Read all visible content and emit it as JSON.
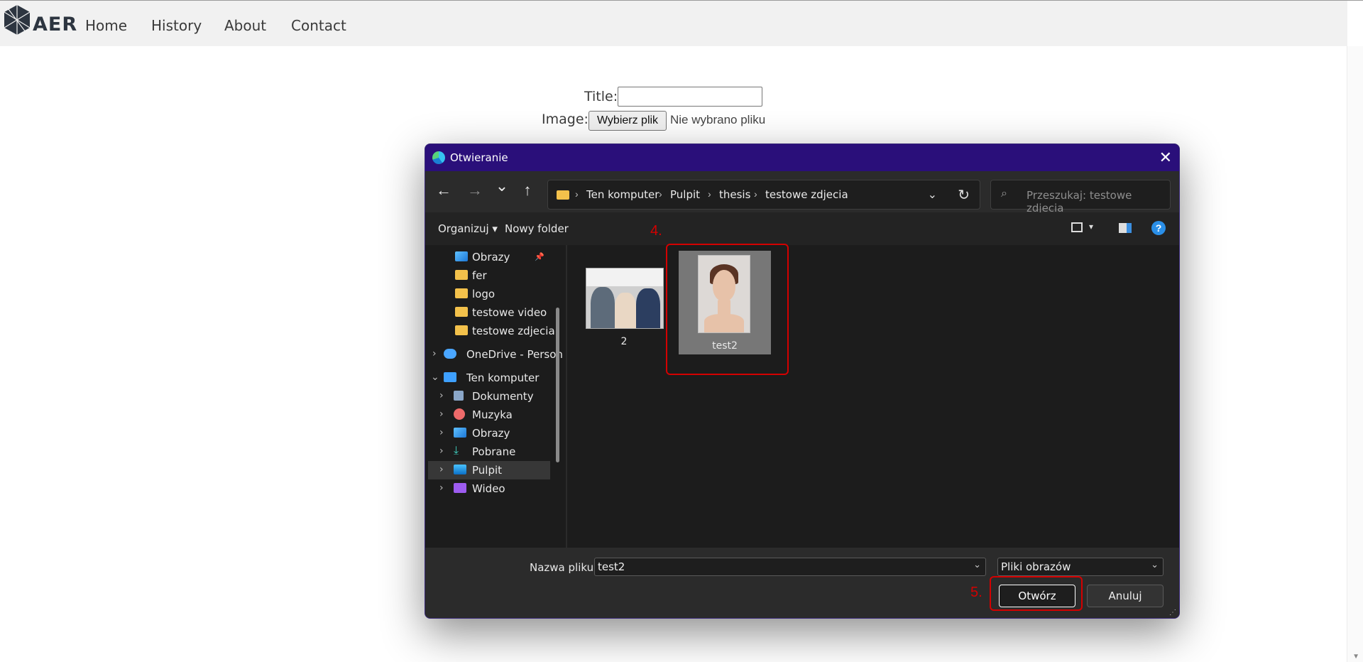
{
  "site": {
    "logo_text": "AER",
    "nav": [
      "Home",
      "History",
      "About",
      "Contact"
    ]
  },
  "form": {
    "title_label": "Title:",
    "image_label": "Image:",
    "file_button": "Wybierz plik",
    "file_status": "Nie wybrano pliku"
  },
  "dialog": {
    "title": "Otwieranie",
    "close": "✕",
    "nav_back": "←",
    "nav_forward": "→",
    "nav_recent": "⌄",
    "nav_up": "↑",
    "breadcrumb": [
      "Ten komputer",
      "Pulpit",
      "thesis",
      "testowe zdjecia"
    ],
    "breadcrumb_sep": "›",
    "search_placeholder": "Przeszukaj: testowe zdjecia",
    "toolbar": {
      "organize": "Organizuj ▾",
      "new_folder": "Nowy folder",
      "help": "?"
    },
    "sidebar": [
      {
        "label": "Obrazy",
        "icon": "pictures-icon",
        "pinned": true
      },
      {
        "label": "fer",
        "icon": "folder-icon"
      },
      {
        "label": "logo",
        "icon": "folder-icon"
      },
      {
        "label": "testowe video",
        "icon": "folder-icon"
      },
      {
        "label": "testowe zdjecia",
        "icon": "folder-icon"
      },
      {
        "label": "OneDrive - Person",
        "icon": "onedrive-icon"
      },
      {
        "label": "Ten komputer",
        "icon": "computer-icon",
        "expanded": true
      },
      {
        "label": "Dokumenty",
        "icon": "documents-icon"
      },
      {
        "label": "Muzyka",
        "icon": "music-icon"
      },
      {
        "label": "Obrazy",
        "icon": "pictures-icon"
      },
      {
        "label": "Pobrane",
        "icon": "download-icon"
      },
      {
        "label": "Pulpit",
        "icon": "desktop-icon",
        "selected": true
      },
      {
        "label": "Wideo",
        "icon": "video-icon"
      }
    ],
    "pin_glyph": "📌",
    "files": [
      {
        "name": "2",
        "selected": false
      },
      {
        "name": "test2",
        "selected": true
      }
    ],
    "filename_label": "Nazwa pliku:",
    "filename_value": "test2",
    "filetype_value": "Pliki obrazów",
    "open_button": "Otwórz",
    "cancel_button": "Anuluj"
  },
  "annotations": {
    "step4": "4.",
    "step5": "5."
  },
  "colors": {
    "titlebar": "#2a0f7a",
    "annotation": "#d40000",
    "dialog_bg": "#1c1c1c"
  }
}
